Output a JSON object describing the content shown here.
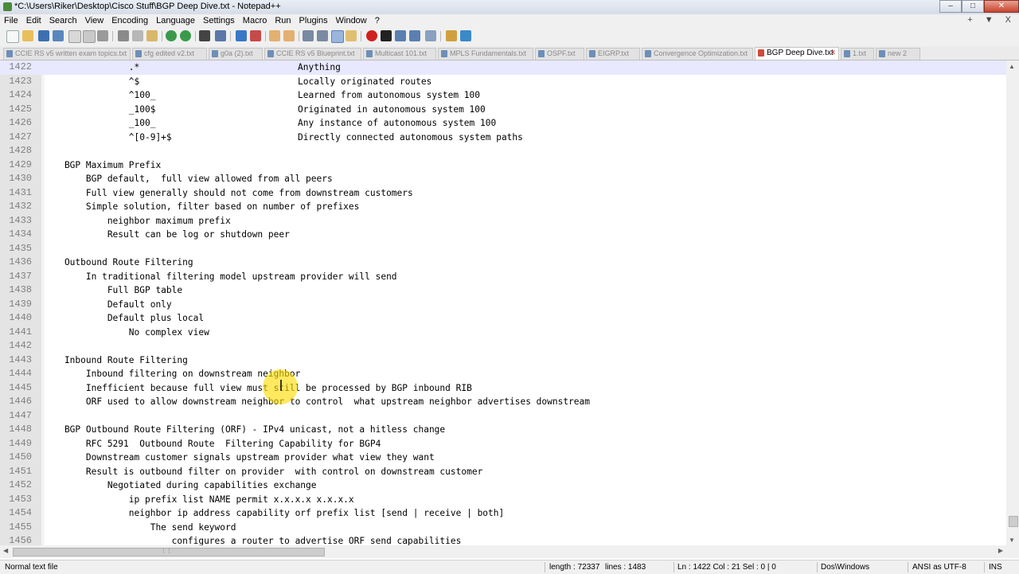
{
  "window": {
    "title": "*C:\\Users\\Riker\\Desktop\\Cisco Stuff\\BGP Deep Dive.txt - Notepad++",
    "controls": [
      "–",
      "□",
      "✕"
    ]
  },
  "menu": {
    "items": [
      "File",
      "Edit",
      "Search",
      "View",
      "Encoding",
      "Language",
      "Settings",
      "Macro",
      "Run",
      "Plugins",
      "Window",
      "?"
    ],
    "right": "+ ▼ X"
  },
  "tabs": [
    {
      "label": "CCIE RS v5 written exam topics.txt",
      "active": false
    },
    {
      "label": "cfg edited v2.txt",
      "active": false
    },
    {
      "label": "g0a (2).txt",
      "active": false
    },
    {
      "label": "CCIE RS v5 Blueprint.txt",
      "active": false
    },
    {
      "label": "Multicast 101.txt",
      "active": false
    },
    {
      "label": "MPLS Fundamentals.txt",
      "active": false
    },
    {
      "label": "OSPF.txt",
      "active": false
    },
    {
      "label": "EIGRP.txt",
      "active": false
    },
    {
      "label": "Convergence Optimization.txt",
      "active": false
    },
    {
      "label": "BGP Deep Dive.txt",
      "active": true
    },
    {
      "label": "1.txt",
      "active": false
    },
    {
      "label": "new 2",
      "active": false
    }
  ],
  "editor": {
    "current_line": "1422",
    "lines": [
      {
        "n": "1422",
        "text": "                .*",
        "col2": "Anything"
      },
      {
        "n": "1423",
        "text": "                ^$",
        "col2": "Locally originated routes"
      },
      {
        "n": "1424",
        "text": "                ^100_",
        "col2": "Learned from autonomous system 100"
      },
      {
        "n": "1425",
        "text": "                _100$",
        "col2": "Originated in autonomous system 100"
      },
      {
        "n": "1426",
        "text": "                _100_",
        "col2": "Any instance of autonomous system 100"
      },
      {
        "n": "1427",
        "text": "                ^[0-9]+$",
        "col2": "Directly connected autonomous system paths"
      },
      {
        "n": "1428",
        "text": ""
      },
      {
        "n": "1429",
        "text": "    BGP Maximum Prefix"
      },
      {
        "n": "1430",
        "text": "        BGP default,  full view allowed from all peers"
      },
      {
        "n": "1431",
        "text": "        Full view generally should not come from downstream customers"
      },
      {
        "n": "1432",
        "text": "        Simple solution, filter based on number of prefixes"
      },
      {
        "n": "1433",
        "text": "            neighbor maximum prefix"
      },
      {
        "n": "1434",
        "text": "            Result can be log or shutdown peer"
      },
      {
        "n": "1435",
        "text": ""
      },
      {
        "n": "1436",
        "text": "    Outbound Route Filtering"
      },
      {
        "n": "1437",
        "text": "        In traditional filtering model upstream provider will send"
      },
      {
        "n": "1438",
        "text": "            Full BGP table"
      },
      {
        "n": "1439",
        "text": "            Default only"
      },
      {
        "n": "1440",
        "text": "            Default plus local"
      },
      {
        "n": "1441",
        "text": "                No complex view"
      },
      {
        "n": "1442",
        "text": ""
      },
      {
        "n": "1443",
        "text": "    Inbound Route Filtering"
      },
      {
        "n": "1444",
        "text": "        Inbound filtering on downstream neighbor"
      },
      {
        "n": "1445",
        "text": "        Inefficient because full view must still be processed by BGP inbound RIB"
      },
      {
        "n": "1446",
        "text": "        ORF used to allow downstream neighbor to control  what upstream neighbor advertises downstream"
      },
      {
        "n": "1447",
        "text": ""
      },
      {
        "n": "1448",
        "text": "    BGP Outbound Route Filtering (ORF) - IPv4 unicast, not a hitless change"
      },
      {
        "n": "1449",
        "text": "        RFC 5291  Outbound Route  Filtering Capability for BGP4"
      },
      {
        "n": "1450",
        "text": "        Downstream customer signals upstream provider what view they want"
      },
      {
        "n": "1451",
        "text": "        Result is outbound filter on provider  with control on downstream customer"
      },
      {
        "n": "1452",
        "text": "            Negotiated during capabilities exchange"
      },
      {
        "n": "1453",
        "text": "                ip prefix list NAME permit x.x.x.x x.x.x.x"
      },
      {
        "n": "1454",
        "text": "                neighbor ip address capability orf prefix list [send | receive | both]"
      },
      {
        "n": "1455",
        "text": "                    The send keyword"
      },
      {
        "n": "1456",
        "text": "                        configures a router to advertise ORF send capabilities"
      }
    ]
  },
  "status": {
    "file_type": "Normal text file",
    "length": "length : 72337",
    "lines": "lines : 1483",
    "position": "Ln : 1422   Col : 21   Sel : 0 | 0",
    "eol": "Dos\\Windows",
    "encoding": "ANSI as UTF-8",
    "mode": "INS"
  },
  "colors": {
    "current_line_bg": "#e8e8ff",
    "gutter_bg": "#e4e4e4",
    "cursor_highlight": "#ffdc00"
  }
}
